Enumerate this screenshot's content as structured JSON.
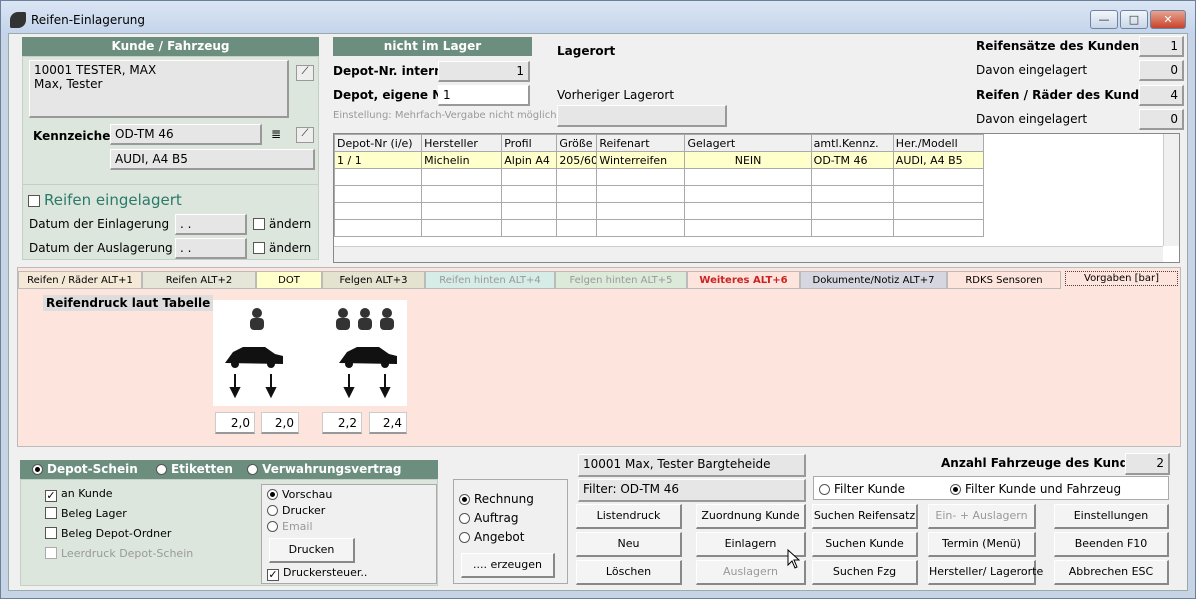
{
  "window": {
    "title": "Reifen-Einlagerung",
    "min": "—",
    "max": "□",
    "close": "✕"
  },
  "customer": {
    "header": "Kunde / Fahrzeug",
    "line1": "10001 TESTER, MAX",
    "line2": "Max, Tester",
    "plate_label": "Kennzeichen",
    "plate": "OD-TM 46",
    "model": "AUDI, A4 B5"
  },
  "storage": {
    "title": "Reifen eingelagert",
    "in_label": "Datum der Einlagerung",
    "in_value": ". .",
    "out_label": "Datum der Auslagerung",
    "out_value": ". .",
    "change": "ändern"
  },
  "depot": {
    "status": "nicht im Lager",
    "intern_label": "Depot-Nr. intern",
    "intern_value": "1",
    "own_label": "Depot, eigene Nr.",
    "own_value": "1",
    "hint": "Einstellung: Mehrfach-Vergabe nicht möglich",
    "location_label": "Lagerort",
    "prev_location_label": "Vorheriger Lagerort"
  },
  "summary": {
    "sets_label": "Reifensätze des Kunden",
    "sets_value": "1",
    "stored1_label": "Davon eingelagert",
    "stored1_value": "0",
    "wheels_label": "Reifen / Räder des Kunden",
    "wheels_value": "4",
    "stored2_label": "Davon eingelagert",
    "stored2_value": "0"
  },
  "grid": {
    "columns": [
      "Depot-Nr (i/e)",
      "Hersteller",
      "Profil",
      "Größe",
      "Reifenart",
      "Gelagert",
      "amtl.Kennz.",
      "Her./Modell"
    ],
    "row": [
      "1 / 1",
      "Michelin",
      "Alpin A4",
      "205/60",
      "Winterreifen",
      "NEIN",
      "OD-TM 46",
      "AUDI, A4 B5"
    ]
  },
  "tabs": [
    "Reifen / Räder ALT+1",
    "Reifen ALT+2",
    "DOT",
    "Felgen ALT+3",
    "Reifen hinten ALT+4",
    "Felgen hinten ALT+5",
    "Weiteres ALT+6",
    "Dokumente/Notiz ALT+7",
    "RDKS Sensoren",
    "Vorgaben [bar]"
  ],
  "pressure": {
    "title": "Reifendruck laut Tabelle",
    "v1": "2,0",
    "v2": "2,0",
    "v3": "2,2",
    "v4": "2,4"
  },
  "print": {
    "options": [
      "Depot-Schein",
      "Etiketten",
      "Verwahrungsvertrag"
    ],
    "c1": "an Kunde",
    "c2": "Beleg Lager",
    "c3": "Beleg Depot-Ordner",
    "c4": "Leerdruck Depot-Schein",
    "out1": "Vorschau",
    "out2": "Drucker",
    "out3": "Email",
    "print_btn": "Drucken",
    "steuer": "Druckersteuer.."
  },
  "doc": {
    "r1": "Rechnung",
    "r2": "Auftrag",
    "r3": "Angebot",
    "create": ".... erzeugen"
  },
  "info": {
    "cust": "10001 Max, Tester Bargteheide",
    "filter": "Filter: OD-TM 46",
    "vehicles_label": "Anzahl Fahrzeuge des Kunden",
    "vehicles_value": "2",
    "f1": "Filter Kunde",
    "f2": "Filter Kunde und Fahrzeug"
  },
  "buttons": {
    "listendruck": "Listendruck",
    "zuordnung": "Zuordnung Kunde",
    "suchen_satz": "Suchen Reifensatz",
    "einaus": "Ein- + Auslagern",
    "einstellungen": "Einstellungen",
    "neu": "Neu",
    "einlagern": "Einlagern",
    "suchen_kunde": "Suchen Kunde",
    "termin": "Termin (Menü)",
    "beenden": "Beenden F10",
    "loeschen": "Löschen",
    "auslagern": "Auslagern",
    "suchen_fzg": "Suchen Fzg",
    "hersteller": "Hersteller/ Lagerorte",
    "abbrechen": "Abbrechen ESC"
  }
}
